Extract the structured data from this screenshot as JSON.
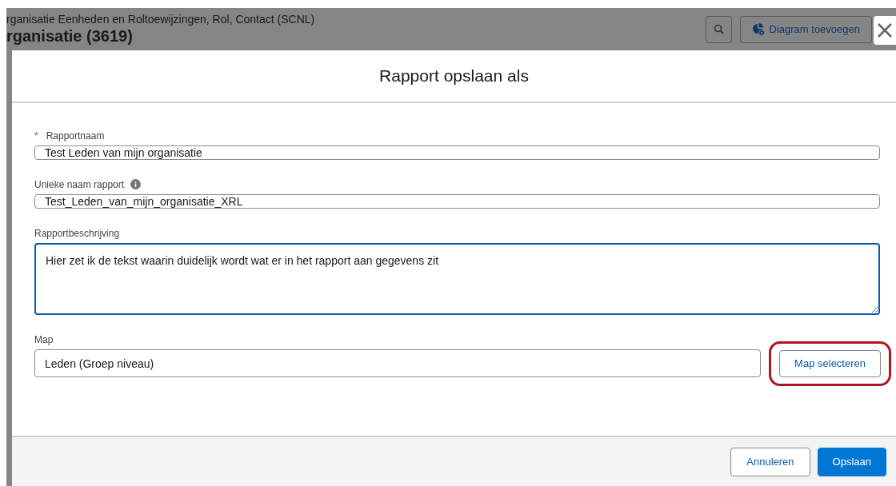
{
  "page_header": {
    "subtitle": "rganisatie Eenheden en Roltoewijzingen, Rol, Contact (SCNL)",
    "title": "rganisatie (3619)",
    "actions": [
      {
        "kind": "search"
      },
      {
        "kind": "chart",
        "label": "Diagram toevoegen"
      }
    ]
  },
  "dialog": {
    "title": "Rapport opslaan als",
    "fields": [
      {
        "kind": "text",
        "label": "Rapportnaam",
        "required_mark": "*",
        "value": "Test Leden van mijn organisatie"
      },
      {
        "kind": "text",
        "label": "Unieke naam rapport",
        "info": true,
        "value": "Test_Leden_van_mijn_organisatie_XRL"
      },
      {
        "kind": "textarea",
        "label": "Rapportbeschrijving",
        "value": "Hier zet ik de tekst waarin duidelijk wordt wat er in het rapport aan gegevens zit",
        "focused": true
      },
      {
        "kind": "picker",
        "label": "Map",
        "value": "Leden (Groep niveau)",
        "button": {
          "label": "Map selecteren",
          "highlighted": true
        }
      }
    ],
    "buttons": [
      {
        "label": "Annuleren",
        "kind": "neutral"
      },
      {
        "label": "Opslaan",
        "kind": "brand"
      }
    ]
  }
}
